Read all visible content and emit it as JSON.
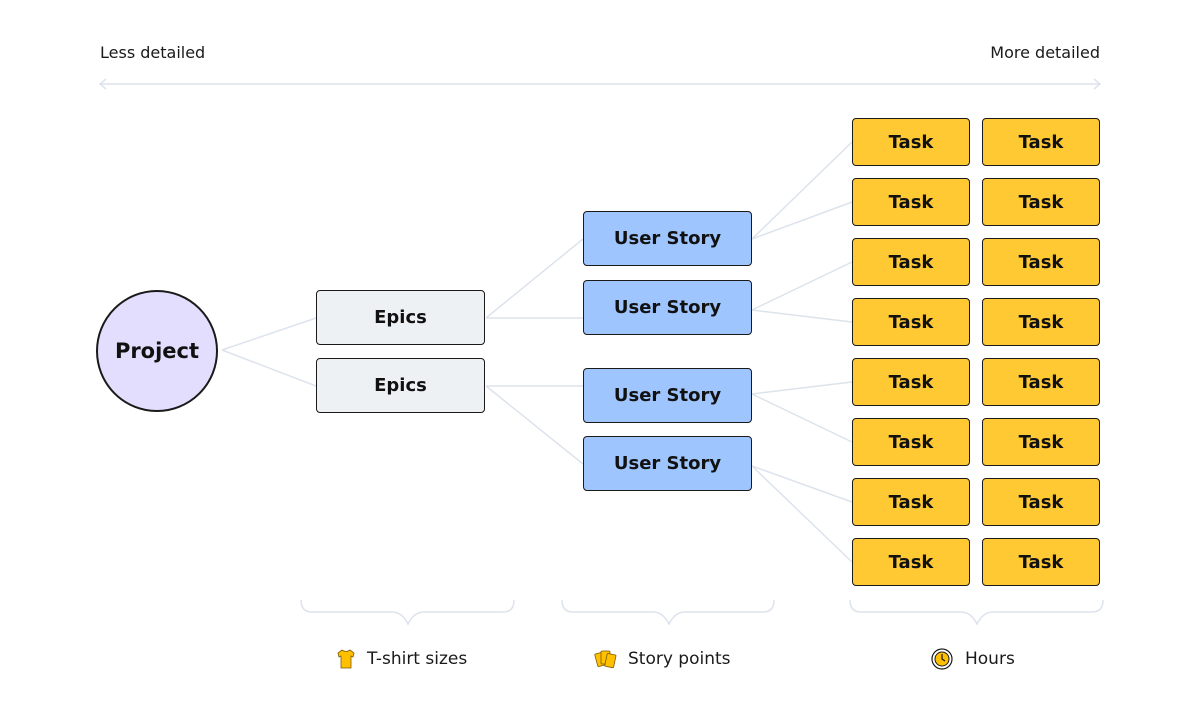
{
  "scale": {
    "left_label": "Less detailed",
    "right_label": "More detailed"
  },
  "project": {
    "label": "Project"
  },
  "epics": [
    {
      "label": "Epics"
    },
    {
      "label": "Epics"
    }
  ],
  "stories": [
    {
      "label": "User Story"
    },
    {
      "label": "User Story"
    },
    {
      "label": "User Story"
    },
    {
      "label": "User Story"
    }
  ],
  "task_label": "Task",
  "legend": [
    {
      "icon": "tshirt-icon",
      "label": "T-shirt sizes"
    },
    {
      "icon": "cards-icon",
      "label": "Story points"
    },
    {
      "icon": "stopwatch-icon",
      "label": "Hours"
    }
  ],
  "colors": {
    "project": "#e4defe",
    "epic": "#eef1f4",
    "story": "#9fc5fe",
    "task": "#ffc933",
    "connector": "#dde3ec"
  }
}
